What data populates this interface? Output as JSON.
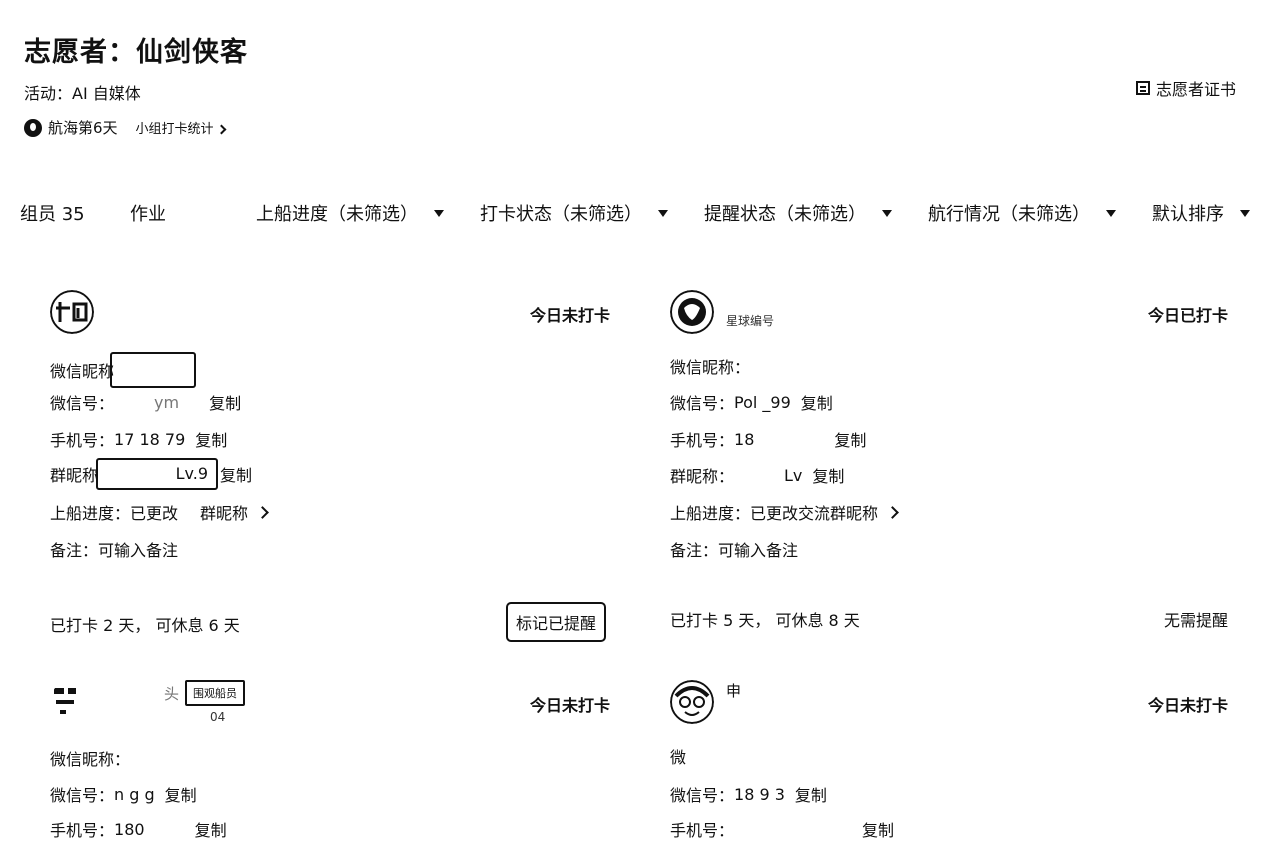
{
  "header": {
    "title": "志愿者：仙剑侠客",
    "activity": "活动：AI 自媒体",
    "voyage_day": "航海第6天",
    "group_stats_link": "小组打卡统计",
    "certificate": "志愿者证书"
  },
  "filters": {
    "members": "组员 35",
    "homework": "作业",
    "boarding": "上船进度（未筛选）",
    "checkin": "打卡状态（未筛选）",
    "reminder": "提醒状态（未筛选）",
    "sailing": "航行情况（未筛选）",
    "sort": "默认排序"
  },
  "cards": [
    {
      "name": "",
      "sub": "",
      "status": "今日未打卡",
      "wechat_nick_label": "微信昵称",
      "wechat_nick": "",
      "wechat_id_label": "微信号：",
      "wechat_id": "ym",
      "phone_label": "手机号：",
      "phone": "17 18 79",
      "group_nick_label": "群昵称",
      "group_nick": "Lv.9",
      "copy": "复制",
      "boarding_label": "上船进度：",
      "boarding": "已更改",
      "boarding_tail": "群昵称",
      "note_label": "备注：",
      "note": "可输入备注",
      "summary": "已打卡 2 天，  可休息 6 天",
      "action": "标记已提醒"
    },
    {
      "name": "",
      "sub": "星球编号",
      "status": "今日已打卡",
      "wechat_nick_label": "微信昵称：",
      "wechat_nick": "",
      "wechat_id_label": "微信号：",
      "wechat_id": "Pol   _99",
      "phone_label": "手机号：",
      "phone": "18",
      "group_nick_label": "群昵称：",
      "group_nick": "Lv",
      "copy": "复制",
      "boarding_label": "上船进度：",
      "boarding": "已更改交流群昵称",
      "note_label": "备注：",
      "note": "可输入备注",
      "summary": "已打卡 5 天，  可休息 8 天",
      "action": "无需提醒"
    },
    {
      "name": "头",
      "badge": "围观船员",
      "sub": "04",
      "status": "今日未打卡",
      "wechat_nick_label": "微信昵称：",
      "wechat_id_label": "微信号：",
      "wechat_id": "n    g  g",
      "phone_label": "手机号：",
      "phone": "180",
      "copy": "复制"
    },
    {
      "name": "申",
      "sub": "",
      "status": "今日未打卡",
      "wechat_nick_label": "微",
      "wechat_id_label": "微信号：",
      "wechat_id": "18  9  3",
      "phone_label": "手机号：",
      "phone": "",
      "copy": "复制"
    }
  ]
}
